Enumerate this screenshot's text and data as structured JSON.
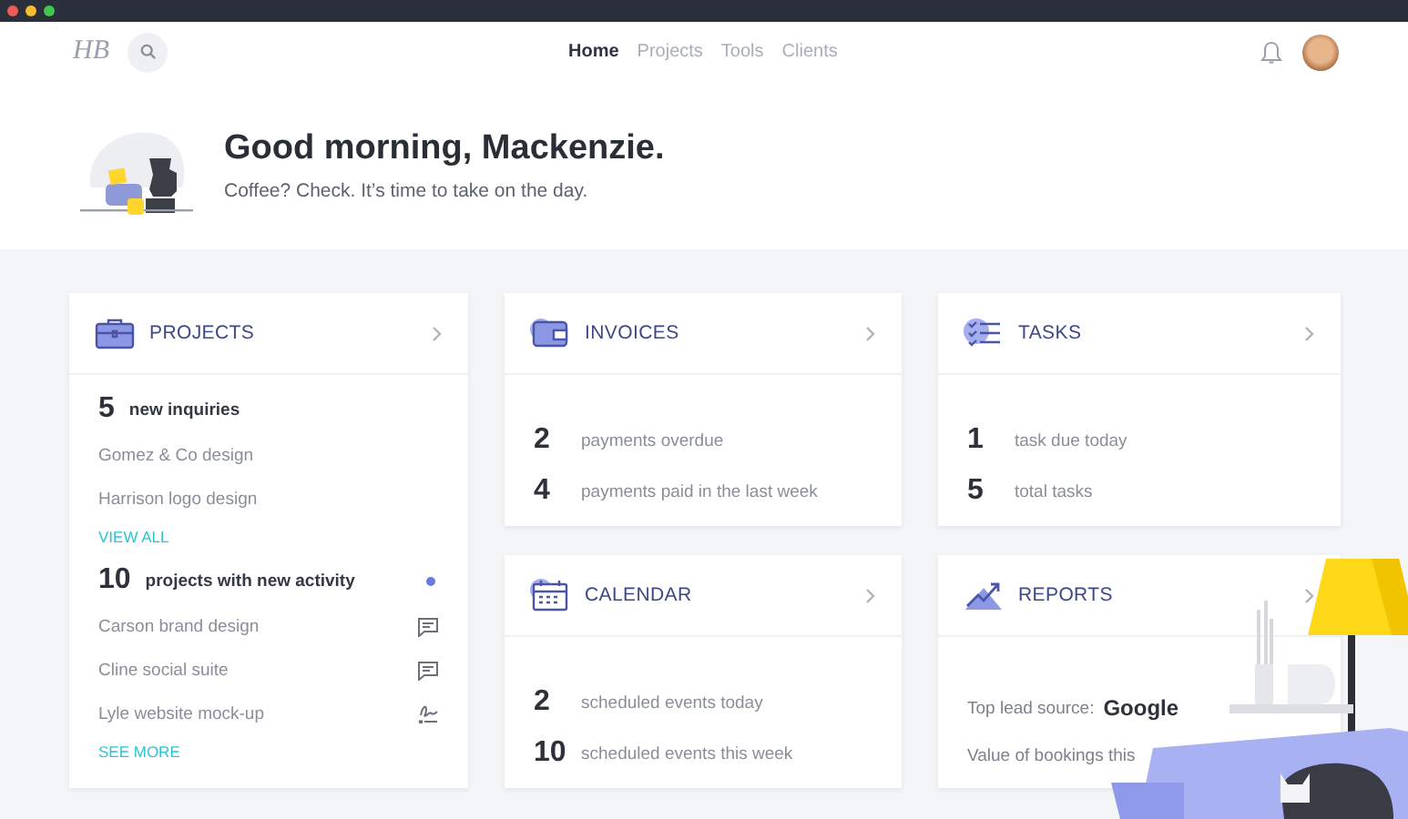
{
  "logo": "HB",
  "nav": {
    "links": [
      {
        "label": "Home",
        "selected": true
      },
      {
        "label": "Projects",
        "selected": false
      },
      {
        "label": "Tools",
        "selected": false
      },
      {
        "label": "Clients",
        "selected": false
      }
    ]
  },
  "greeting": {
    "title": "Good morning, Mackenzie.",
    "subtitle": "Coffee? Check. It’s time to take on the day."
  },
  "cards": [
    {
      "kind": "sections",
      "title": "PROJECTS",
      "sections": [
        {
          "count": "5",
          "label": "new inquiries",
          "unread": false,
          "items": [
            {
              "name": "Gomez & Co design",
              "kind": "plain"
            },
            {
              "name": "Harrison logo design",
              "kind": "plain"
            }
          ],
          "link": "VIEW ALL"
        },
        {
          "count": "10",
          "label": "projects with new activity",
          "unread": true,
          "items": [
            {
              "name": "Carson brand design",
              "kind": "comment"
            },
            {
              "name": "Cline social suite",
              "kind": "comment"
            },
            {
              "name": "Lyle website mock-up",
              "kind": "signature"
            }
          ],
          "link": "SEE MORE"
        }
      ]
    },
    {
      "kind": "stats",
      "title": "INVOICES",
      "stats": [
        {
          "count": "2",
          "label": "payments overdue"
        },
        {
          "count": "4",
          "label": "payments paid in the last week"
        }
      ]
    },
    {
      "kind": "stats",
      "title": "TASKS",
      "stats": [
        {
          "count": "1",
          "label": "task due today"
        },
        {
          "count": "5",
          "label": "total tasks"
        }
      ]
    },
    {
      "kind": "stats",
      "title": "CALENDAR",
      "stats": [
        {
          "count": "2",
          "label": "scheduled events today"
        },
        {
          "count": "10",
          "label": "scheduled events this week"
        }
      ]
    },
    {
      "kind": "facts",
      "title": "REPORTS",
      "facts": [
        {
          "label": "Top lead source:",
          "value": "Google"
        },
        {
          "label": "Value of bookings this"
        }
      ]
    }
  ]
}
